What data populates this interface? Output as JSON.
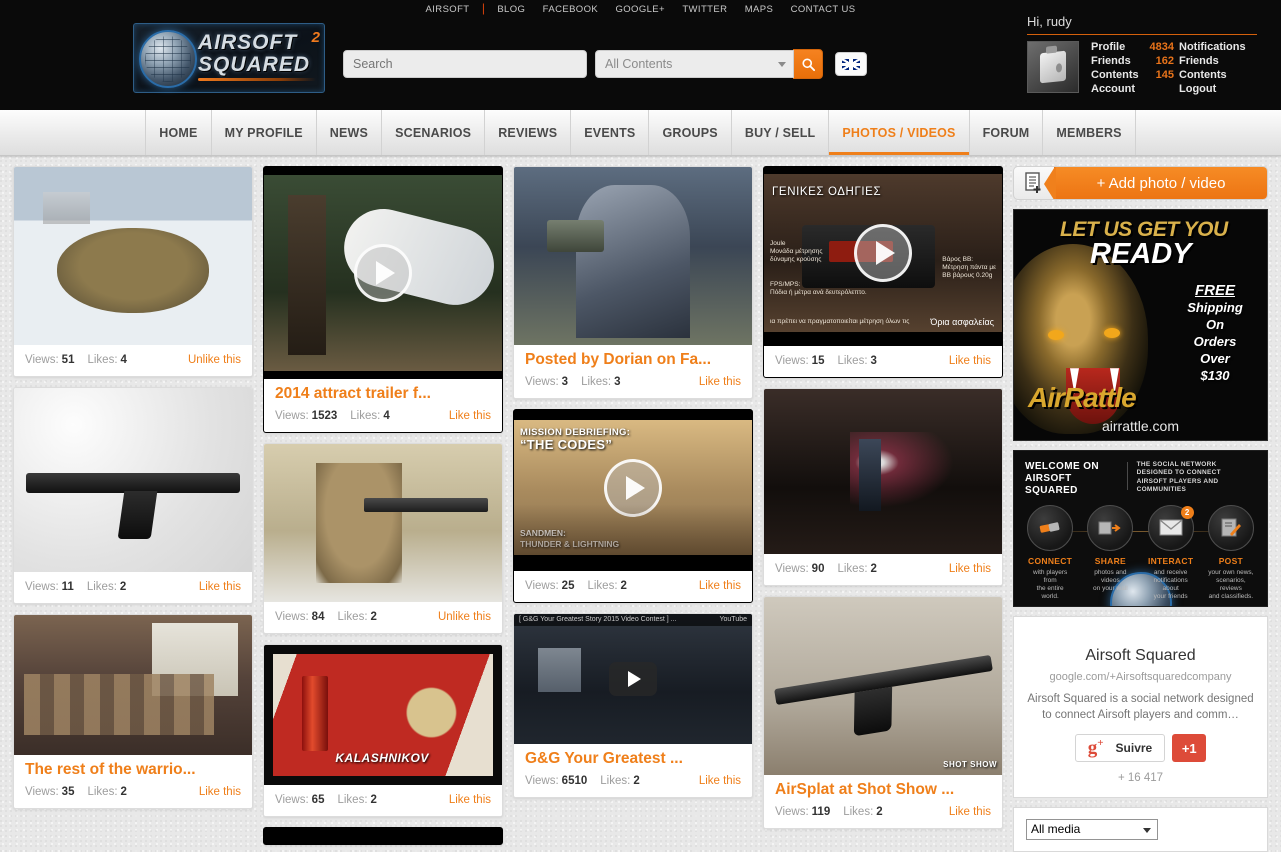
{
  "top_links": [
    {
      "label": "AIRSOFT"
    },
    {
      "label": "BLOG"
    },
    {
      "label": "FACEBOOK"
    },
    {
      "label": "GOOGLE+"
    },
    {
      "label": "TWITTER"
    },
    {
      "label": "MAPS"
    },
    {
      "label": "CONTACT US"
    }
  ],
  "logo": {
    "line1": "AIRSOFT",
    "line2": "SQUARED",
    "sup": "2"
  },
  "search": {
    "placeholder": "Search",
    "value": "",
    "scope": "All Contents",
    "search_icon": "magnifier-icon",
    "language": "en-gb-flag"
  },
  "user": {
    "greeting": "Hi, rudy",
    "links": [
      {
        "label": "Profile",
        "count": "4834",
        "count_label": "Notifications"
      },
      {
        "label": "Friends",
        "count": "162",
        "count_label": "Friends"
      },
      {
        "label": "Contents",
        "count": "145",
        "count_label": "Contents"
      },
      {
        "label": "Account",
        "count": "",
        "count_label": "Logout"
      }
    ]
  },
  "nav": [
    {
      "label": "HOME",
      "active": false
    },
    {
      "label": "MY PROFILE",
      "active": false
    },
    {
      "label": "NEWS",
      "active": false
    },
    {
      "label": "SCENARIOS",
      "active": false
    },
    {
      "label": "REVIEWS",
      "active": false
    },
    {
      "label": "EVENTS",
      "active": false
    },
    {
      "label": "GROUPS",
      "active": false
    },
    {
      "label": "BUY / SELL",
      "active": false
    },
    {
      "label": "PHOTOS / VIDEOS",
      "active": true
    },
    {
      "label": "FORUM",
      "active": false
    },
    {
      "label": "MEMBERS",
      "active": false
    }
  ],
  "labels": {
    "views": "Views:",
    "likes": "Likes:"
  },
  "cards": {
    "c1": {
      "title": "",
      "views": "51",
      "likes": "4",
      "action": "Unlike this"
    },
    "c2": {
      "title": "",
      "views": "11",
      "likes": "2",
      "action": "Like this"
    },
    "c3": {
      "title": "The rest of the warrio...",
      "views": "35",
      "likes": "2",
      "action": "Like this"
    },
    "c4": {
      "title": "2014 attract trailer f...",
      "views": "1523",
      "likes": "4",
      "action": "Like this"
    },
    "c5": {
      "title": "",
      "views": "84",
      "likes": "2",
      "action": "Unlike this"
    },
    "c6": {
      "title": "",
      "views": "65",
      "likes": "2",
      "action": "Like this"
    },
    "c7": {
      "title": "Posted by Dorian on Fa...",
      "views": "3",
      "likes": "3",
      "action": "Like this"
    },
    "c8": {
      "title": "",
      "views": "25",
      "likes": "2",
      "action": "Like this"
    },
    "c9": {
      "title": "G&G Your Greatest ...",
      "views": "6510",
      "likes": "2",
      "action": "Like this"
    },
    "c10": {
      "title": "",
      "views": "15",
      "likes": "3",
      "action": "Like this"
    },
    "c11": {
      "title": "",
      "views": "90",
      "likes": "2",
      "action": "Like this"
    },
    "c12": {
      "title": "AirSplat at Shot Show ...",
      "views": "119",
      "likes": "2",
      "action": "Like this"
    }
  },
  "thumb_text": {
    "kalashnikov": "KALASHNIKOV",
    "codes_line1": "MISSION DEBRIEFING:",
    "codes_line2": "“THE CODES”",
    "codes_btm1": "SANDMEN:",
    "codes_btm2": "THUNDER & LIGHTNING",
    "gg_bar_left": "[ G&G Your Greatest Story 2015 Video Contest ] ...",
    "gg_bar_right": "YouTube",
    "greek_header": "ΓΕΝΙΚΕΣ ΟΔΗΓΙΕΣ",
    "greek_l1": "Joule\nΜονάδα μέτρησης\nδύναμης κρούσης",
    "greek_l2": "FPS/MPS:\nΠόδια ή μέτρα ανά δευτερόλεπτο.",
    "greek_l3": "Βάρος BB:\nΜέτρηση πάντα με\nBB βάρους 0.20g",
    "greek_l4": "ια πρέπει να πραγματοποιείται μέτρηση όλων τις",
    "greek_l5": "Όρια ασφαλείας",
    "shotshow": "SHOT SHOW"
  },
  "sidebar": {
    "add_label": "+ Add photo / video",
    "add_icon": "document-add-icon",
    "ad": {
      "line1": "LET US GET YOU",
      "line2": "READY",
      "free": "FREE",
      "free_rest": "Shipping\nOn\nOrders\nOver\n$130",
      "brand": "AirRattle",
      "url": "airrattle.com"
    },
    "welcome": {
      "title": "WELCOME ON\nAIRSOFT SQUARED",
      "tagline": "THE SOCIAL NETWORK\nDESIGNED TO CONNECT\nAIRSOFT PLAYERS AND COMMUNITIES",
      "items": [
        {
          "icon": "handshake-icon",
          "label": "CONNECT",
          "desc": "with players from\nthe entire world.",
          "badge": ""
        },
        {
          "icon": "share-icon",
          "label": "SHARE",
          "desc": "photos and videos\non your wall",
          "badge": ""
        },
        {
          "icon": "envelope-icon",
          "label": "INTERACT",
          "desc": "and receive\nnotifications about\nyour friends",
          "badge": "2"
        },
        {
          "icon": "pencil-note-icon",
          "label": "POST",
          "desc": "your own news,\nscenarios, reviews\nand classifieds.",
          "badge": ""
        }
      ]
    },
    "gplus": {
      "name": "Airsoft Squared",
      "url": "google.com/+Airsoftsquaredcompany",
      "description": "Airsoft Squared is a social network designed to connect Airsoft players and comm…",
      "follow_label": "Suivre",
      "plus_label": "+1",
      "count": "+ 16 417"
    },
    "filter": {
      "value": "All media"
    }
  }
}
